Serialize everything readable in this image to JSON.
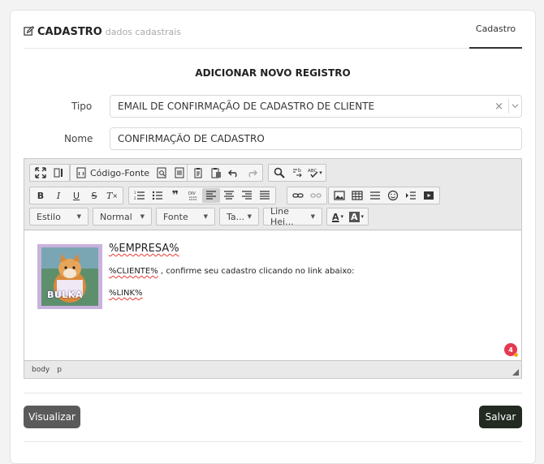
{
  "header": {
    "title": "CADASTRO",
    "subtitle": "dados cadastrais",
    "tab_label": "Cadastro"
  },
  "form": {
    "section_title": "ADICIONAR NOVO REGISTRO",
    "tipo_label": "Tipo",
    "tipo_value": "EMAIL DE CONFIRMAÇÃO DE CADASTRO DE CLIENTE",
    "nome_label": "Nome",
    "nome_value": "CONFIRMAÇÃO DE CADASTRO"
  },
  "toolbar": {
    "source_label": "Código-Fonte",
    "style_combo": "Estilo",
    "format_combo": "Normal",
    "font_combo": "Fonte",
    "size_combo": "Ta...",
    "line_height_combo": "Line Hei...",
    "text_color_label": "A",
    "bg_color_label": "A",
    "bold": "B",
    "italic": "I",
    "underline": "U",
    "strike": "S",
    "remove_format": "T",
    "blockquote": "❞"
  },
  "content": {
    "company": "%EMPRESA%",
    "client_token": "%CLIENTE%",
    "client_rest": " , confirme seu cadastro clicando no link abaixo:",
    "link_token": "%LINK%",
    "image_text": "BULKA"
  },
  "statusbar": {
    "path": [
      "body",
      "p"
    ]
  },
  "badge": {
    "count": "4"
  },
  "buttons": {
    "preview": "Visualizar",
    "save": "Salvar"
  },
  "colors": {
    "save_bg": "#222a22",
    "preview_bg": "#5a5a5a",
    "badge": "#e53950",
    "spell_underline": "#e53935",
    "image_bg": "#c9b2dd"
  }
}
